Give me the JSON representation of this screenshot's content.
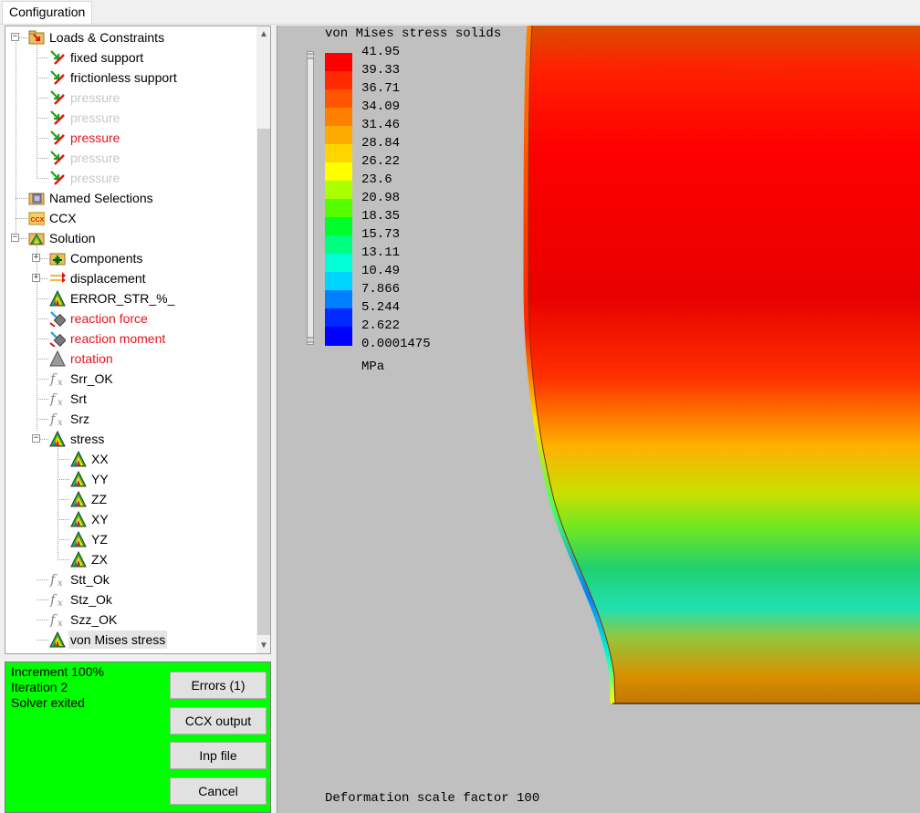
{
  "tabs": {
    "configuration": "Configuration"
  },
  "tree": {
    "items": [
      {
        "label": "Loads & Constraints",
        "style": "normal"
      },
      {
        "label": "fixed support",
        "style": "normal"
      },
      {
        "label": "frictionless support",
        "style": "normal"
      },
      {
        "label": "pressure",
        "style": "disabled"
      },
      {
        "label": "pressure",
        "style": "disabled"
      },
      {
        "label": "pressure",
        "style": "red"
      },
      {
        "label": "pressure",
        "style": "disabled"
      },
      {
        "label": "pressure",
        "style": "disabled"
      },
      {
        "label": "Named Selections",
        "style": "normal"
      },
      {
        "label": "CCX",
        "style": "normal"
      },
      {
        "label": "Solution",
        "style": "normal"
      },
      {
        "label": "Components",
        "style": "normal"
      },
      {
        "label": "displacement",
        "style": "normal"
      },
      {
        "label": "ERROR_STR_%_",
        "style": "normal"
      },
      {
        "label": "reaction force",
        "style": "red"
      },
      {
        "label": "reaction moment",
        "style": "red"
      },
      {
        "label": "rotation",
        "style": "red"
      },
      {
        "label": "Srr_OK",
        "style": "normal"
      },
      {
        "label": "Srt",
        "style": "normal"
      },
      {
        "label": "Srz",
        "style": "normal"
      },
      {
        "label": "stress",
        "style": "normal"
      },
      {
        "label": "XX",
        "style": "normal"
      },
      {
        "label": "YY",
        "style": "normal"
      },
      {
        "label": "ZZ",
        "style": "normal"
      },
      {
        "label": "XY",
        "style": "normal"
      },
      {
        "label": "YZ",
        "style": "normal"
      },
      {
        "label": "ZX",
        "style": "normal"
      },
      {
        "label": "Stt_Ok",
        "style": "normal"
      },
      {
        "label": "Stz_Ok",
        "style": "normal"
      },
      {
        "label": "Szz_OK",
        "style": "normal"
      },
      {
        "label": "von Mises stress",
        "style": "selected"
      }
    ],
    "ccx_icon_text": "CCX"
  },
  "status": {
    "increment": "Increment  100%",
    "iteration": "Iteration  2",
    "solver": "Solver exited",
    "errors_button": "Errors (1)",
    "ccx_output_button": "CCX output",
    "inp_file_button": "Inp file",
    "cancel_button": "Cancel",
    "background_color": "#00ff00"
  },
  "viewer": {
    "legend_title": "von Mises stress solids",
    "legend_ticks": [
      "41.95",
      "39.33",
      "36.71",
      "34.09",
      "31.46",
      "28.84",
      "26.22",
      "23.6",
      "20.98",
      "18.35",
      "15.73",
      "13.11",
      "10.49",
      "7.866",
      "5.244",
      "2.622",
      "0.0001475"
    ],
    "unit": "MPa",
    "deformation_text": "Deformation scale factor 100",
    "colors": [
      "#ff0000",
      "#ff2a00",
      "#ff5500",
      "#ff8000",
      "#ffaa00",
      "#ffd500",
      "#ffff00",
      "#aaff00",
      "#55ff00",
      "#00ff2a",
      "#00ff80",
      "#00ffd5",
      "#00d5ff",
      "#0080ff",
      "#002aff",
      "#0000ff"
    ]
  }
}
